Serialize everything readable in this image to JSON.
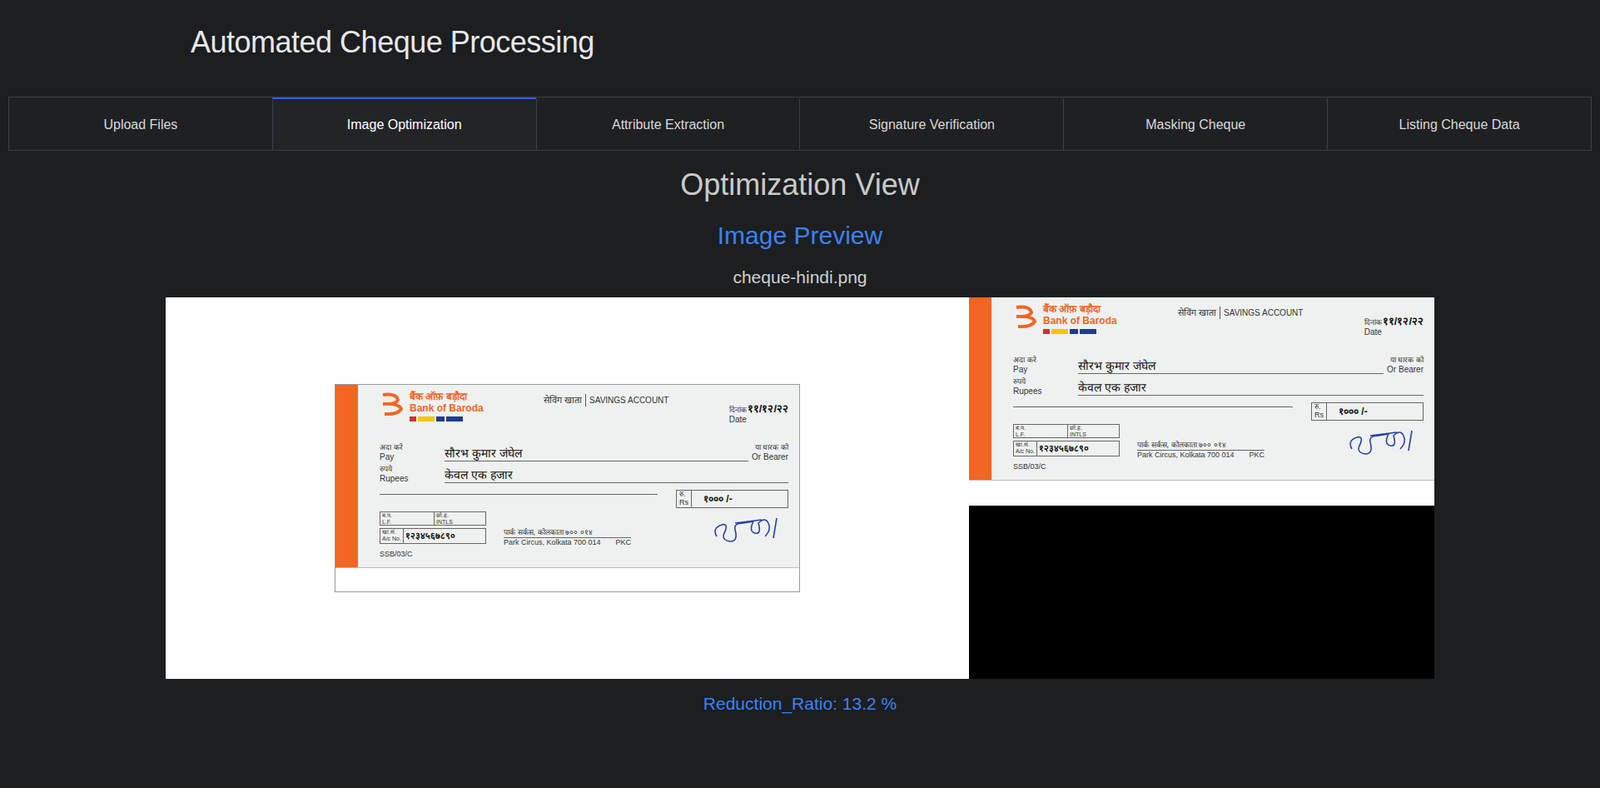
{
  "app": {
    "title": "Automated Cheque Processing"
  },
  "tabs": [
    {
      "label": "Upload Files",
      "selected": false
    },
    {
      "label": "Image Optimization",
      "selected": true
    },
    {
      "label": "Attribute Extraction",
      "selected": false
    },
    {
      "label": "Signature Verification",
      "selected": false
    },
    {
      "label": "Masking Cheque",
      "selected": false
    },
    {
      "label": "Listing Cheque Data",
      "selected": false
    }
  ],
  "view": {
    "heading": "Optimization View",
    "subheading": "Image Preview",
    "file_name": "cheque-hindi.png"
  },
  "cheque": {
    "bank_hindi": "बैंक ऑफ़ बड़ौदा",
    "bank": "Bank of Baroda",
    "account_type_hindi": "सेविंग खाता",
    "account_type": "SAVINGS ACCOUNT",
    "date_label_hindi": "दिनांक",
    "date": "११/१२/२२",
    "date_label": "Date",
    "pay_hindi": "अदा करे",
    "pay": "Pay",
    "payee": "सौरभ कुमार जंघेल",
    "bearer_hindi": "या धारक को",
    "bearer": "Or Bearer",
    "rupees_hindi": "रुपये",
    "rupees": "Rupees",
    "amount_words": "केवल एक हजार",
    "rs_hindi": "रु.",
    "rs": "Rs",
    "amount": "१००० /-",
    "lf_hindi": "ब.प.",
    "lf": "L.F.",
    "intls_hindi": "छो.ह.",
    "intls": "INTLS",
    "acno_hindi": "खा.सं.",
    "acno": "A/c No.",
    "account_number": "१२३४५६७८९०",
    "branch_hindi": "पार्क सर्कस, कोलकाता ७०० ०१४",
    "branch": "Park Circus, Kolkata 700 014",
    "branch_code": "PKC",
    "cheque_code": "SSB/03/C"
  },
  "previews": [
    {
      "kind": "original"
    },
    {
      "kind": "optimized"
    }
  ],
  "reduction": "Reduction_Ratio: 13.2 %"
}
